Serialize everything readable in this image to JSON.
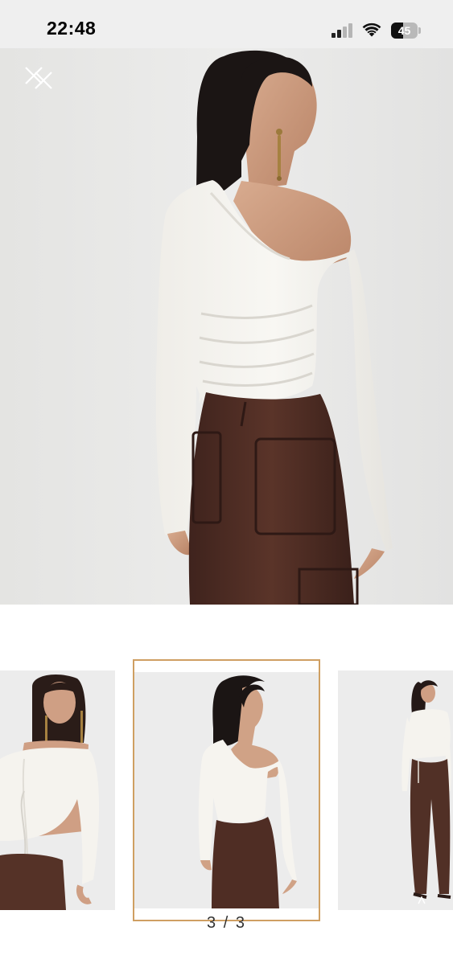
{
  "status_bar": {
    "time": "22:48",
    "battery_level": 45,
    "battery_label": "45",
    "icons": [
      "signal-icon",
      "wifi-icon",
      "battery-icon"
    ]
  },
  "viewer": {
    "close_icon": "close-icon",
    "counter": "3 / 3",
    "selected_index": 3,
    "thumbnail_count": 3,
    "accent_color": "#cf9f62"
  },
  "colors": {
    "top": "#f6f5f1",
    "pants": "#4a2a22",
    "background": "#e9e9e8"
  }
}
